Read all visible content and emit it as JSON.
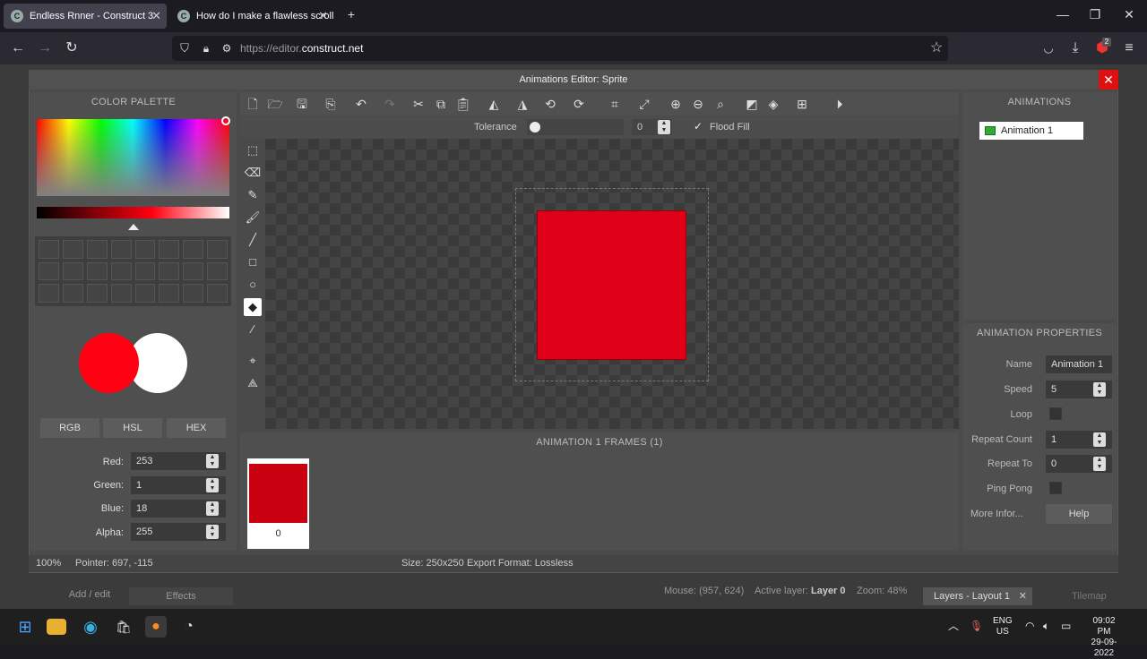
{
  "browser": {
    "tabs": [
      {
        "title": "Endless Rnner - Construct 3"
      },
      {
        "title": "How do I make a flawless scrolli"
      }
    ],
    "url_prefix": "https://editor.",
    "url_domain": "construct.net",
    "badge": "2"
  },
  "editor": {
    "title": "Animations Editor: Sprite"
  },
  "color_palette": {
    "heading": "COLOR PALETTE",
    "primary_color": "#fd0112",
    "secondary_color": "#ffffff",
    "mode_buttons": [
      "RGB",
      "HSL",
      "HEX"
    ],
    "fields": [
      {
        "label": "Red:",
        "value": "253"
      },
      {
        "label": "Green:",
        "value": "1"
      },
      {
        "label": "Blue:",
        "value": "18"
      },
      {
        "label": "Alpha:",
        "value": "255"
      }
    ]
  },
  "options": {
    "tolerance_label": "Tolerance",
    "tolerance_value": "0",
    "flood_fill_label": "Flood Fill"
  },
  "frames": {
    "heading": "ANIMATION 1 FRAMES (1)",
    "items": [
      {
        "index": "0",
        "color": "#c8000f"
      }
    ]
  },
  "animations": {
    "heading": "ANIMATIONS",
    "items": [
      {
        "name": "Animation 1"
      }
    ]
  },
  "properties": {
    "heading": "ANIMATION PROPERTIES",
    "name_label": "Name",
    "name_value": "Animation 1",
    "speed_label": "Speed",
    "speed_value": "5",
    "loop_label": "Loop",
    "repeat_count_label": "Repeat Count",
    "repeat_count_value": "1",
    "repeat_to_label": "Repeat To",
    "repeat_to_value": "0",
    "ping_pong_label": "Ping Pong",
    "more_info_label": "More Infor...",
    "help_label": "Help"
  },
  "status": {
    "zoom": "100%",
    "pointer": "Pointer: 697, -115",
    "size": "Size: 250x250",
    "export_format": "Export Format: Lossless"
  },
  "construct_status": {
    "mouse": "Mouse: (957, 624)",
    "active_layer_label": "Active layer:",
    "active_layer": "Layer 0",
    "zoom": "Zoom: 48%",
    "layers_tab": "Layers - Layout 1",
    "tilemap_tab": "Tilemap",
    "add_edit": "Add / edit",
    "effects": "Effects"
  },
  "taskbar": {
    "lang": "ENG",
    "region": "US",
    "time": "09:02 PM",
    "date": "29-09-2022"
  }
}
